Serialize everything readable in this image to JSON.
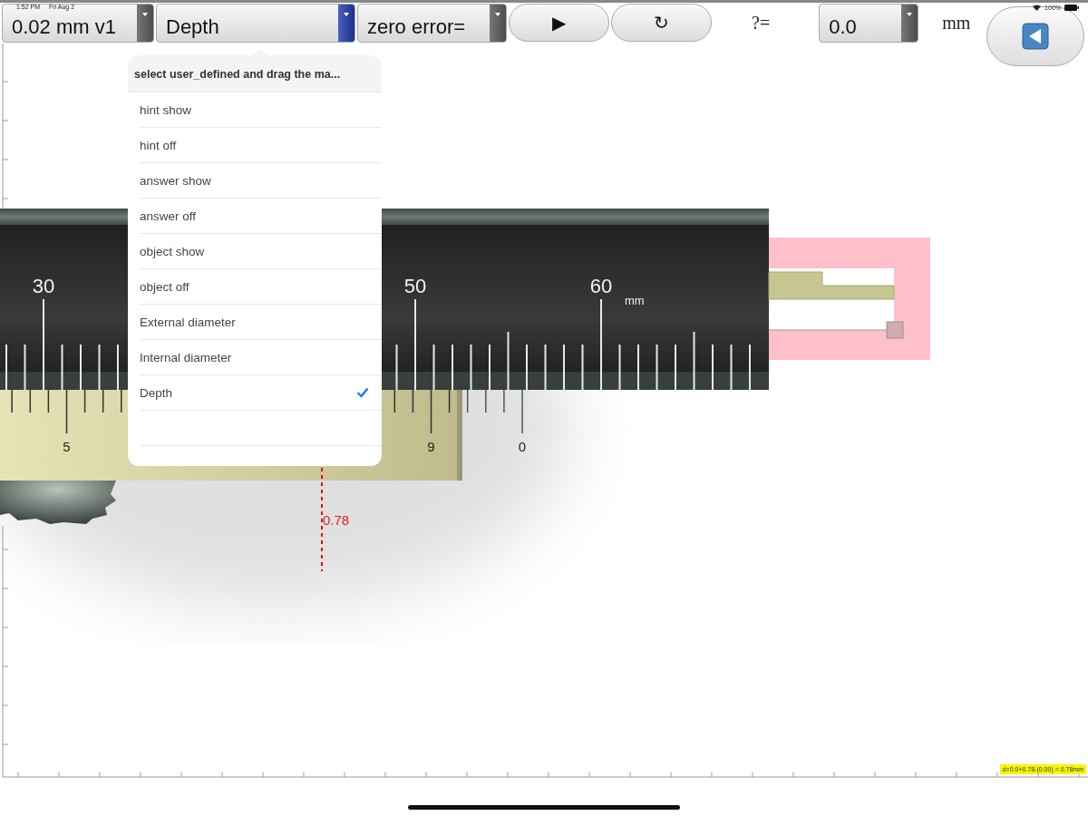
{
  "status_bar": {
    "time": "1:52 PM",
    "date": "Fri Aug 2",
    "battery": "100%"
  },
  "toolbar": {
    "resolution_dropdown": {
      "value": "0.02 mm v1",
      "open": false
    },
    "mode_dropdown": {
      "value": "Depth",
      "open": true
    },
    "zero_error_dropdown": {
      "value": "zero error=",
      "open": false
    },
    "play_button": "▶",
    "reset_button": "↻",
    "answer_label": "?=",
    "answer_dropdown": {
      "value": "0.0",
      "open": false
    },
    "unit": "mm"
  },
  "mode_menu": {
    "header": "select user_defined and drag the ma...",
    "items": [
      {
        "label": "hint show",
        "selected": false
      },
      {
        "label": "hint off",
        "selected": false
      },
      {
        "label": "answer show",
        "selected": false
      },
      {
        "label": "answer off",
        "selected": false
      },
      {
        "label": "object show",
        "selected": false
      },
      {
        "label": "object off",
        "selected": false
      },
      {
        "label": "External diameter",
        "selected": false
      },
      {
        "label": "Internal diameter",
        "selected": false
      },
      {
        "label": "Depth",
        "selected": true
      }
    ]
  },
  "caliper": {
    "main_scale_labels": [
      "30",
      "50",
      "60"
    ],
    "main_scale_unit": "mm",
    "vernier_labels": [
      "5",
      "9",
      "0"
    ],
    "reading": "0.78"
  },
  "formula": "d=0.0+0.78-(0.00) = 0.78mm"
}
